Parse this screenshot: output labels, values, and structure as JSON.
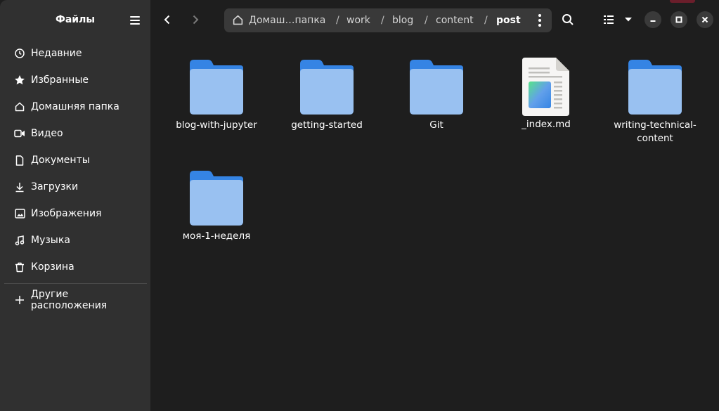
{
  "sidebar": {
    "title": "Файлы",
    "items": [
      {
        "label": "Недавние",
        "icon": "clock-icon"
      },
      {
        "label": "Избранные",
        "icon": "star-icon"
      },
      {
        "label": "Домашняя папка",
        "icon": "home-icon"
      },
      {
        "label": "Видео",
        "icon": "video-icon"
      },
      {
        "label": "Документы",
        "icon": "document-icon"
      },
      {
        "label": "Загрузки",
        "icon": "download-icon"
      },
      {
        "label": "Изображения",
        "icon": "image-icon"
      },
      {
        "label": "Музыка",
        "icon": "music-icon"
      },
      {
        "label": "Корзина",
        "icon": "trash-icon"
      }
    ],
    "other_locations": {
      "label": "Другие расположения",
      "icon": "plus-icon"
    }
  },
  "pathbar": {
    "crumbs": [
      "Домаш…папка",
      "work",
      "blog",
      "content",
      "post"
    ],
    "separator": "/"
  },
  "files": [
    {
      "name": "blog-with-jupyter",
      "type": "folder"
    },
    {
      "name": "getting-started",
      "type": "folder"
    },
    {
      "name": "Git",
      "type": "folder"
    },
    {
      "name": "_index.md",
      "type": "file"
    },
    {
      "name_line1": "writing-technical-",
      "name_line2": "content",
      "type": "folder"
    },
    {
      "name": "моя-1-неделя",
      "type": "folder"
    }
  ],
  "colors": {
    "sidebar_bg": "#303030",
    "content_bg": "#1e1e1e",
    "folder_back": "#3584e4",
    "folder_front": "#99c1f1"
  }
}
